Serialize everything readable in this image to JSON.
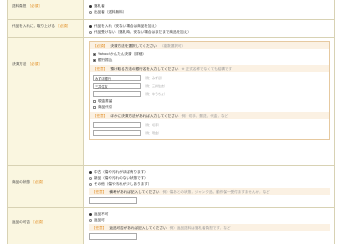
{
  "rows": {
    "shipping": {
      "label": "送料負担",
      "req": "［必須］",
      "options": [
        "落札者",
        "出品者（送料無料）"
      ],
      "selected": 0
    },
    "substitute": {
      "label": "代品を入れに，取り上げる",
      "req": "［必須］",
      "options": [
        "代品を入れ（安ない場合は商品を加え）",
        "代品受けない（落札時，安ない場合はまだまで商品を加え）"
      ],
      "selected": 0
    },
    "payment": {
      "label": "決済方法",
      "req": "［必須］",
      "box1": {
        "tag": "【必須】",
        "title": "決済方法を選択してください",
        "note": "（複数選択可）",
        "checks": [
          "Yahoo!かんたん決済（詳細）",
          "銀行振込"
        ]
      },
      "box2": {
        "tag": "【任意】",
        "title": "預け取る方法の銀行名を入力してください",
        "note": "※ 正式名称でなくても結構です",
        "banks": [
          {
            "value": "みずほ銀行",
            "hint": "（例：みずほ）"
          },
          {
            "value": "三井住友",
            "hint": "（例：三井住友）"
          },
          {
            "value": "",
            "hint": "（例：ゆうちょ）"
          }
        ],
        "extras": [
          "現金書留",
          "商品代引"
        ]
      },
      "box3": {
        "tag": "【任意】",
        "title": "ほかに決済方法があれば入力してください",
        "note": "例）切手，郵送，代金，など",
        "inputs": [
          {
            "hint": "（例：切手）"
          },
          {
            "hint": "（例：現金）"
          }
        ]
      }
    },
    "condition": {
      "label": "商品の状態",
      "req": "［必須］",
      "options": [
        "中古（傷や汚れがほぼ有ります）",
        "新品（傷や汚れのない状態です）",
        "その他（傷や汚れが少しあります）"
      ],
      "selected": 0,
      "box": {
        "tag": "【任意】",
        "title": "備考があれば記入してください",
        "note": "例）傷あとの状態，ジャンク品，動作保一受付ますませんか，など"
      }
    },
    "returns": {
      "label": "返品の可否",
      "req": "［必須］",
      "options": [
        "返品不可",
        "返品可"
      ],
      "selected": 0,
      "box": {
        "tag": "【任意】",
        "title": "返品可否があれば記入してください",
        "note": "例）返品送料は落札者負担です，など"
      }
    }
  },
  "colors": {
    "label_bg": "#faf6e0",
    "accent": "#e08a1e",
    "border": "#d8d2b4",
    "box_border": "#e6c9a0"
  }
}
